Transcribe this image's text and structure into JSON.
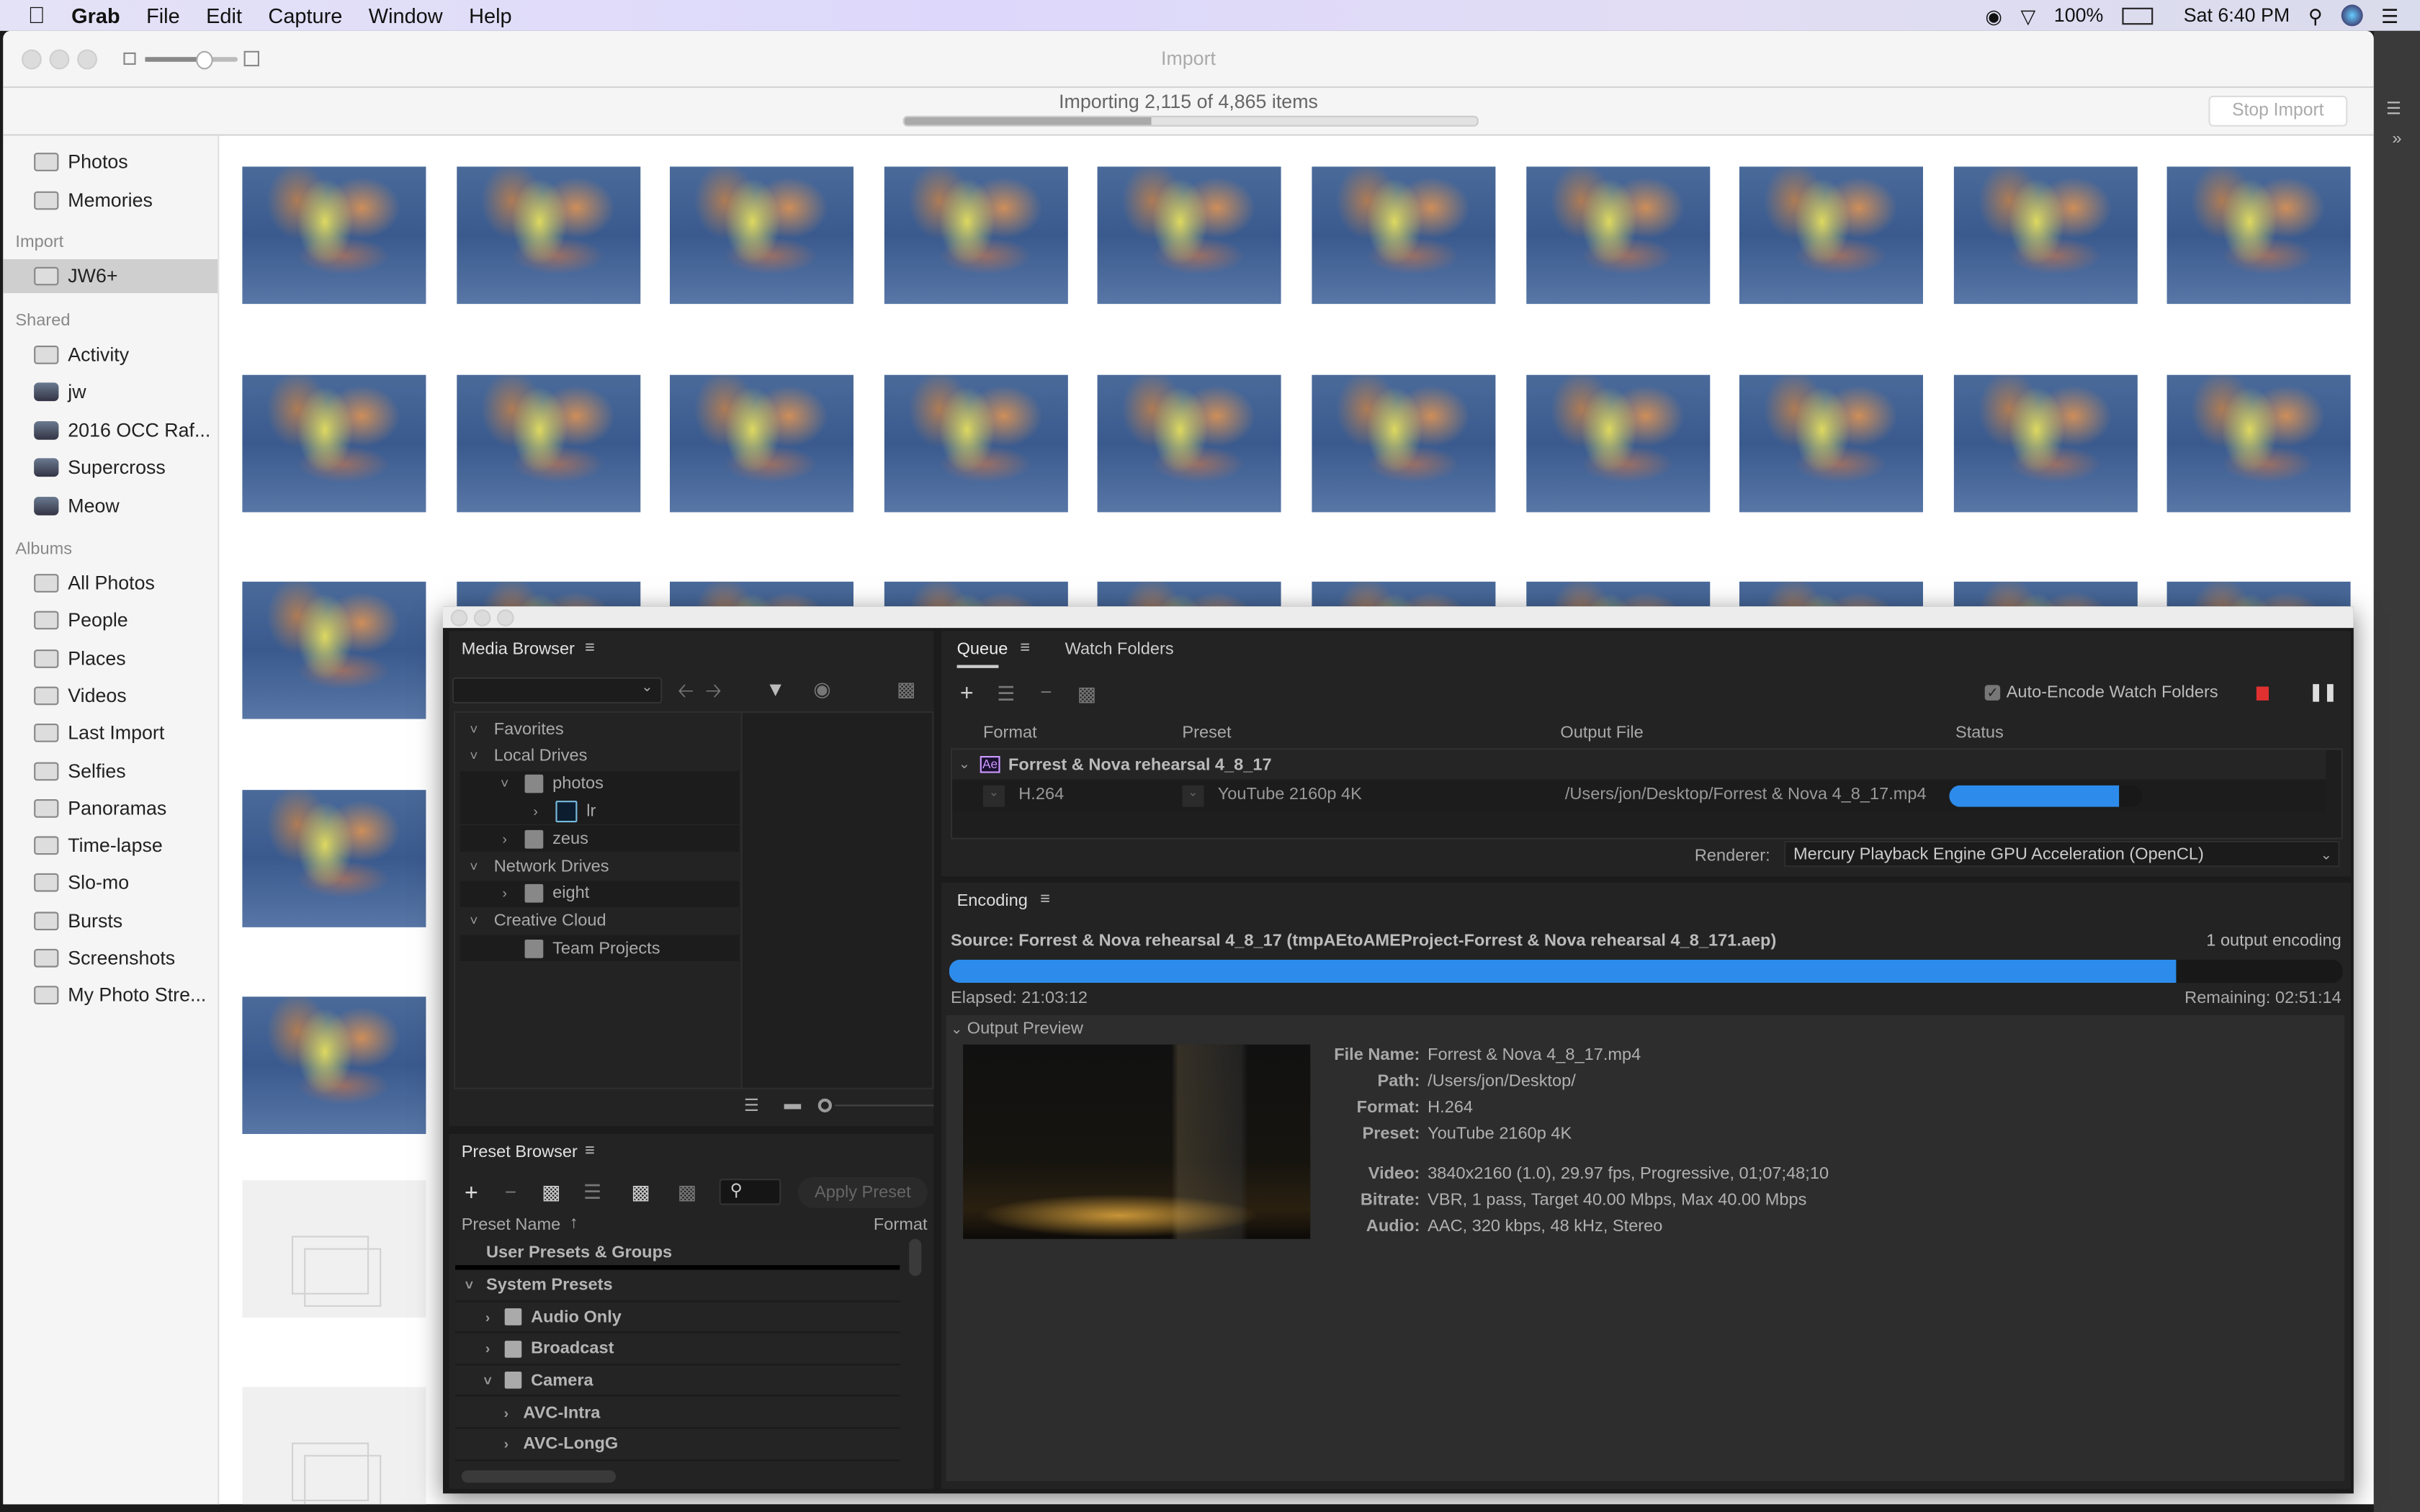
{
  "menubar": {
    "app": "Grab",
    "items": [
      "File",
      "Edit",
      "Capture",
      "Window",
      "Help"
    ],
    "battery": "100%",
    "clock": "Sat 6:40 PM"
  },
  "photos_window": {
    "title": "Import",
    "import_status": "Importing 2,115 of 4,865 items",
    "import_progress": 0.43,
    "stop_button": "Stop Import",
    "sidebar": {
      "top": [
        {
          "label": "Photos",
          "icon": "photos-icon"
        },
        {
          "label": "Memories",
          "icon": "memories-icon"
        }
      ],
      "import_header": "Import",
      "import_items": [
        {
          "label": "JW6+",
          "icon": "phone-icon"
        }
      ],
      "shared_header": "Shared",
      "shared_items": [
        {
          "label": "Activity",
          "icon": "cloud-icon"
        },
        {
          "label": "jw",
          "icon": "album-thumb"
        },
        {
          "label": "2016 OCC Raf...",
          "icon": "album-thumb"
        },
        {
          "label": "Supercross",
          "icon": "album-thumb"
        },
        {
          "label": "Meow",
          "icon": "album-thumb"
        }
      ],
      "albums_header": "Albums",
      "album_items": [
        {
          "label": "All Photos",
          "icon": "photos-icon"
        },
        {
          "label": "People",
          "icon": "person-icon"
        },
        {
          "label": "Places",
          "icon": "pin-icon"
        },
        {
          "label": "Videos",
          "icon": "video-icon"
        },
        {
          "label": "Last Import",
          "icon": "clock-icon"
        },
        {
          "label": "Selfies",
          "icon": "camera-icon"
        },
        {
          "label": "Panoramas",
          "icon": "panorama-icon"
        },
        {
          "label": "Time-lapse",
          "icon": "timelapse-icon"
        },
        {
          "label": "Slo-mo",
          "icon": "slomo-icon"
        },
        {
          "label": "Bursts",
          "icon": "bursts-icon"
        },
        {
          "label": "Screenshots",
          "icon": "screenshot-icon"
        },
        {
          "label": "My Photo Stre...",
          "icon": "cloud-icon"
        }
      ]
    }
  },
  "ame": {
    "media_browser": {
      "title": "Media Browser",
      "tree": [
        {
          "label": "Favorites",
          "level": 0,
          "exp": "v"
        },
        {
          "label": "Local Drives",
          "level": 0,
          "exp": "v"
        },
        {
          "label": "photos",
          "level": 1,
          "exp": "v"
        },
        {
          "label": "lr",
          "level": 2,
          "exp": ">"
        },
        {
          "label": "zeus",
          "level": 1,
          "exp": ">"
        },
        {
          "label": "Network Drives",
          "level": 0,
          "exp": "v"
        },
        {
          "label": "eight",
          "level": 1,
          "exp": ">"
        },
        {
          "label": "Creative Cloud",
          "level": 0,
          "exp": "v"
        },
        {
          "label": "Team Projects",
          "level": 1,
          "exp": ""
        }
      ]
    },
    "preset_browser": {
      "title": "Preset Browser",
      "apply_button": "Apply Preset",
      "col_name": "Preset Name",
      "col_format": "Format",
      "rows": [
        {
          "label": "User Presets & Groups",
          "level": 0,
          "exp": ""
        },
        {
          "label": "System Presets",
          "level": 0,
          "exp": "v"
        },
        {
          "label": "Audio Only",
          "level": 1,
          "exp": ">"
        },
        {
          "label": "Broadcast",
          "level": 1,
          "exp": ">"
        },
        {
          "label": "Camera",
          "level": 1,
          "exp": "v"
        },
        {
          "label": "AVC-Intra",
          "level": 2,
          "exp": ">"
        },
        {
          "label": "AVC-LongG",
          "level": 2,
          "exp": ">"
        }
      ]
    },
    "queue": {
      "tab_queue": "Queue",
      "tab_watch": "Watch Folders",
      "auto_encode": "Auto-Encode Watch Folders",
      "columns": [
        "Format",
        "Preset",
        "Output File",
        "Status"
      ],
      "item": {
        "name": "Forrest & Nova rehearsal 4_8_17",
        "format": "H.264",
        "preset": "YouTube 2160p 4K",
        "output": "/Users/jon/Desktop/Forrest & Nova 4_8_17.mp4",
        "progress": 0.88
      },
      "renderer_label": "Renderer:",
      "renderer": "Mercury Playback Engine GPU Acceleration (OpenCL)"
    },
    "encoding": {
      "title": "Encoding",
      "source": "Source: Forrest & Nova rehearsal 4_8_17 (tmpAEtoAMEProject-Forrest & Nova rehearsal 4_8_171.aep)",
      "outputs": "1 output encoding",
      "progress": 0.88,
      "elapsed": "Elapsed: 21:03:12",
      "remaining": "Remaining: 02:51:14",
      "preview_label": "Output Preview",
      "details": [
        {
          "k": "File Name:",
          "v": "Forrest & Nova 4_8_17.mp4"
        },
        {
          "k": "Path:",
          "v": "/Users/jon/Desktop/"
        },
        {
          "k": "Format:",
          "v": "H.264"
        },
        {
          "k": "Preset:",
          "v": "YouTube 2160p 4K"
        },
        {
          "k": "Video:",
          "v": "3840x2160 (1.0), 29.97 fps, Progressive, 01;07;48;10"
        },
        {
          "k": "Bitrate:",
          "v": "VBR, 1 pass, Target 40.00 Mbps, Max 40.00 Mbps"
        },
        {
          "k": "Audio:",
          "v": "AAC, 320 kbps, 48 kHz, Stereo"
        }
      ]
    }
  }
}
